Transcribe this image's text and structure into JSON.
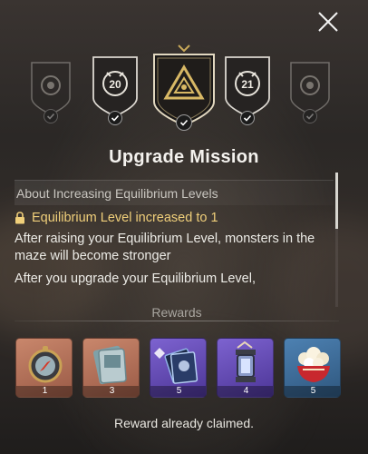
{
  "header": {
    "title": "Upgrade Mission",
    "close_icon": "close-x-icon"
  },
  "badges": [
    {
      "id": "badge-left-far",
      "label": "",
      "icon": "emblem-icon",
      "claimed": true,
      "selected": false
    },
    {
      "id": "badge-20",
      "label": "20",
      "icon": "level-emblem-icon",
      "claimed": true,
      "selected": false
    },
    {
      "id": "badge-current",
      "label": "",
      "icon": "eye-triangle-icon",
      "claimed": true,
      "selected": true
    },
    {
      "id": "badge-21",
      "label": "21",
      "icon": "level-emblem-icon",
      "claimed": true,
      "selected": false
    },
    {
      "id": "badge-right-far",
      "label": "",
      "icon": "emblem-icon",
      "claimed": true,
      "selected": false
    }
  ],
  "content": {
    "section_title": "About Increasing Equilibrium Levels",
    "status": "Equilibrium Level increased to 1",
    "paragraph1": "After raising your Equilibrium Level, monsters in the maze will become stronger",
    "paragraph2": "After you upgrade your Equilibrium Level,"
  },
  "rewards": {
    "title": "Rewards",
    "items": [
      {
        "name": "compass-item",
        "qty": "1",
        "bg": "#b8705a"
      },
      {
        "name": "ticket-item",
        "qty": "3",
        "bg": "#b8705a"
      },
      {
        "name": "card-pack-item",
        "qty": "5",
        "bg": "#6a4fb8"
      },
      {
        "name": "lantern-item",
        "qty": "4",
        "bg": "#6a4fb8"
      },
      {
        "name": "popcorn-item",
        "qty": "5",
        "bg": "#3f6f9c"
      }
    ]
  },
  "footer": {
    "status": "Reward already claimed."
  },
  "colors": {
    "accent_gold": "#f0cf7a",
    "text_primary": "#ecebe6"
  }
}
